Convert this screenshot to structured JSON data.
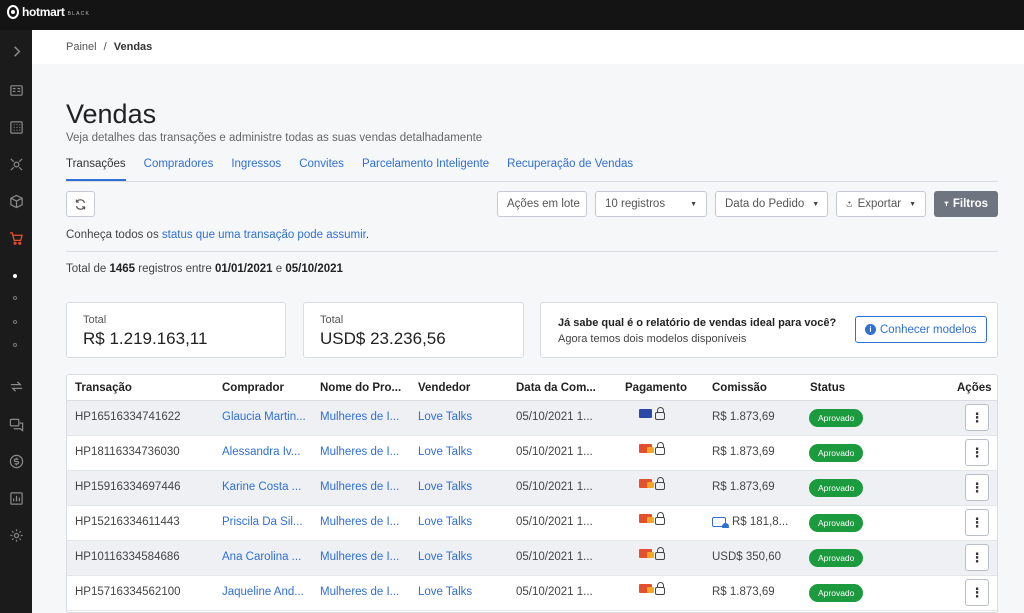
{
  "brand": {
    "name": "hotmart",
    "tier": "BLACK"
  },
  "breadcrumb": {
    "root": "Painel",
    "separator": "/",
    "current": "Vendas"
  },
  "page": {
    "title": "Vendas",
    "subtitle": "Veja detalhes das transações e administre todas as suas vendas detalhadamente"
  },
  "tabs": [
    {
      "label": "Transações",
      "active": true
    },
    {
      "label": "Compradores"
    },
    {
      "label": "Ingressos"
    },
    {
      "label": "Convites"
    },
    {
      "label": "Parcelamento Inteligente"
    },
    {
      "label": "Recuperação de Vendas"
    }
  ],
  "toolbar": {
    "bulk_actions": "Ações em lote",
    "page_size": "10 registros",
    "sort_by": "Data do Pedido",
    "export": "Exportar",
    "filters": "Filtros"
  },
  "status_note": {
    "prefix": "Conheça todos os",
    "link": "status que uma transação pode assumir",
    "suffix": "."
  },
  "summary": {
    "prefix": "Total de",
    "count": "1465",
    "middle": "registros entre",
    "start": "01/01/2021",
    "and": "e",
    "end": "05/10/2021"
  },
  "totals": [
    {
      "label": "Total",
      "value": "R$ 1.219.163,11"
    },
    {
      "label": "Total",
      "value": "USD$ 23.236,56"
    }
  ],
  "promo": {
    "question": "Já sabe qual é o relatório de vendas ideal para você?",
    "text": "Agora temos dois modelos disponíveis",
    "button": "Conhecer modelos"
  },
  "table": {
    "columns": [
      "Transação",
      "Comprador",
      "Nome do Pro...",
      "Vendedor",
      "Data da Com...",
      "Pagamento",
      "Comissão",
      "Status",
      "Ações"
    ],
    "rows": [
      {
        "transaction": "HP16516334741622",
        "buyer": "Glaucia Martin...",
        "product": "Mulheres de I...",
        "seller": "Love Talks",
        "date": "05/10/2021 1...",
        "payment": "visa",
        "commission": "R$ 1.873,69",
        "status": "Aprovado"
      },
      {
        "transaction": "HP18116334736030",
        "buyer": "Alessandra Iv...",
        "product": "Mulheres de I...",
        "seller": "Love Talks",
        "date": "05/10/2021 1...",
        "payment": "mastercard",
        "commission": "R$ 1.873,69",
        "status": "Aprovado"
      },
      {
        "transaction": "HP15916334697446",
        "buyer": "Karine Costa ...",
        "product": "Mulheres de I...",
        "seller": "Love Talks",
        "date": "05/10/2021 1...",
        "payment": "mastercard",
        "commission": "R$ 1.873,69",
        "status": "Aprovado"
      },
      {
        "transaction": "HP15216334611443",
        "buyer": "Priscila Da Sil...",
        "product": "Mulheres de I...",
        "seller": "Love Talks",
        "date": "05/10/2021 1...",
        "payment": "mastercard",
        "commission": "R$ 181,8...",
        "status": "Aprovado",
        "commission_icon": true
      },
      {
        "transaction": "HP10116334584686",
        "buyer": "Ana Carolina ...",
        "product": "Mulheres de I...",
        "seller": "Love Talks",
        "date": "05/10/2021 1...",
        "payment": "mastercard",
        "commission": "USD$ 350,60",
        "status": "Aprovado"
      },
      {
        "transaction": "HP15716334562100",
        "buyer": "Jaqueline And...",
        "product": "Mulheres de I...",
        "seller": "Love Talks",
        "date": "05/10/2021 1...",
        "payment": "mastercard",
        "commission": "R$ 1.873,69",
        "status": "Aprovado"
      }
    ],
    "row_menu": "⋮"
  },
  "colors": {
    "accent": "#2f6fd6",
    "approved": "#1c9a3e",
    "active_nav": "#e4502e"
  }
}
